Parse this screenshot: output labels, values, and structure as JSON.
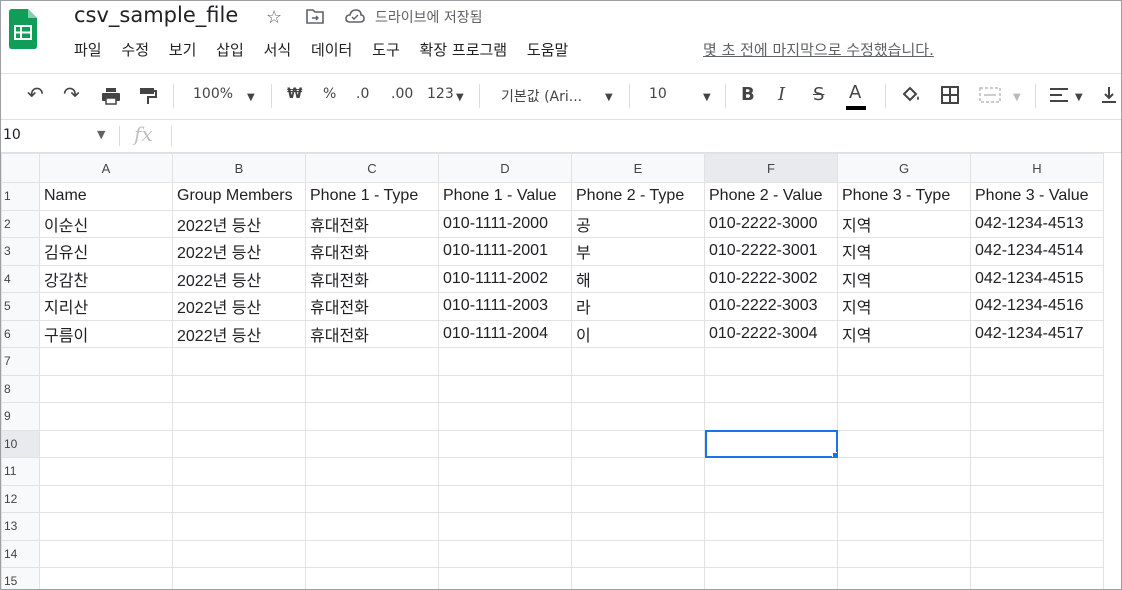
{
  "doc": {
    "title": "csv_sample_file",
    "saved_status": "드라이브에 저장됨",
    "last_edit": "몇 초 전에 마지막으로 수정했습니다."
  },
  "menu": [
    "파일",
    "수정",
    "보기",
    "삽입",
    "서식",
    "데이터",
    "도구",
    "확장 프로그램",
    "도움말"
  ],
  "toolbar": {
    "zoom": "100%",
    "currency": "₩",
    "percent": "%",
    "dec_decrease": ".0",
    "dec_increase": ".00",
    "more_formats": "123",
    "font": "기본값 (Ari...",
    "font_size": "10"
  },
  "formula_bar": {
    "name_box": "10",
    "fx": "fx"
  },
  "sheet": {
    "columns": [
      "A",
      "B",
      "C",
      "D",
      "E",
      "F",
      "G",
      "H"
    ],
    "row_numbers": [
      "1",
      "2",
      "3",
      "4",
      "5",
      "6",
      "7",
      "8",
      "9",
      "10",
      "11",
      "12",
      "13",
      "14",
      "15"
    ],
    "rows": [
      [
        "Name",
        "Group Members",
        "Phone 1 - Type",
        "Phone 1 - Value",
        "Phone 2 - Type",
        "Phone 2 - Value",
        "Phone 3 - Type",
        "Phone 3 - Value"
      ],
      [
        "이순신",
        "2022년 등산",
        "휴대전화",
        "010-1111-2000",
        "공",
        "010-2222-3000",
        "지역",
        "042-1234-4513"
      ],
      [
        "김유신",
        "2022년 등산",
        "휴대전화",
        "010-1111-2001",
        "부",
        "010-2222-3001",
        "지역",
        "042-1234-4514"
      ],
      [
        "강감찬",
        "2022년 등산",
        "휴대전화",
        "010-1111-2002",
        "해",
        "010-2222-3002",
        "지역",
        "042-1234-4515"
      ],
      [
        "지리산",
        "2022년 등산",
        "휴대전화",
        "010-1111-2003",
        "라",
        "010-2222-3003",
        "지역",
        "042-1234-4516"
      ],
      [
        "구름이",
        "2022년 등산",
        "휴대전화",
        "010-1111-2004",
        "이",
        "010-2222-3004",
        "지역",
        "042-1234-4517"
      ]
    ],
    "selected_cell": "F10",
    "accent_color": "#1a73e8",
    "brand_color": "#0f9d58"
  }
}
